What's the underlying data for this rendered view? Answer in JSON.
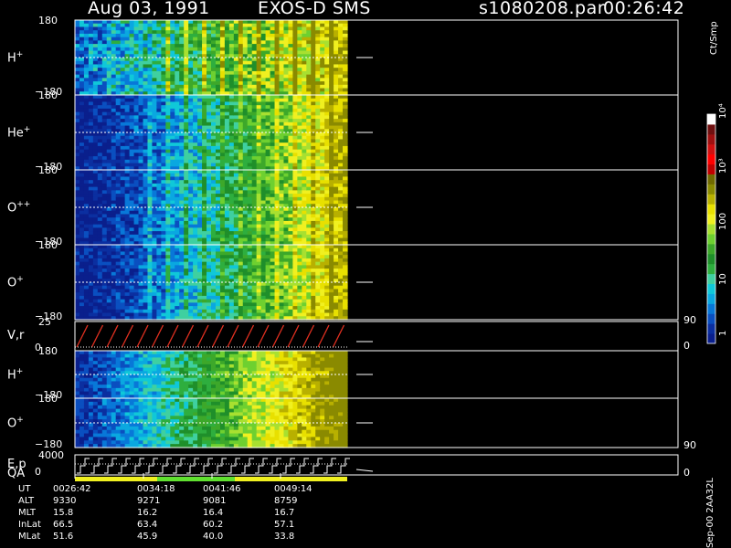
{
  "header": {
    "date": "Aug 03, 1991",
    "instrument": "EXOS-D SMS",
    "file": "s1080208.par",
    "time": "00:26:42"
  },
  "panels": [
    {
      "label": "H",
      "sup": "+",
      "top": "180",
      "bottom": "−180"
    },
    {
      "label": "He",
      "sup": "+",
      "top": "180",
      "bottom": "−180"
    },
    {
      "label": "O",
      "sup": "++",
      "top": "180",
      "bottom": "−180"
    },
    {
      "label": "O",
      "sup": "+",
      "top": "180",
      "bottom": "−180"
    },
    {
      "label": "V,r",
      "sup": "",
      "top": "25",
      "bottom": "0"
    },
    {
      "label": "H",
      "sup": "+",
      "top": "180",
      "bottom": "−180"
    },
    {
      "label": "O",
      "sup": "+",
      "top": "180",
      "bottom": "−180"
    },
    {
      "label": "E,p",
      "sup": "",
      "top": "4000",
      "bottom": "0"
    }
  ],
  "qa_label": "QA",
  "right_axis": {
    "vr_top": "90",
    "vr_bottom": "0",
    "ep_top": "90",
    "ep_bottom": "0"
  },
  "colorbar": {
    "unit": "Ct/Smp",
    "ticks": [
      "1",
      "10",
      "100",
      "10³",
      "10⁴"
    ],
    "colors": [
      "#0a1f8c",
      "#0b2fa0",
      "#0a4fc0",
      "#0878d8",
      "#0aa8e0",
      "#10c8d8",
      "#3fd0a0",
      "#2eae3e",
      "#1f8f2a",
      "#3da82a",
      "#6ed030",
      "#a8e030",
      "#f0f020",
      "#e8e000",
      "#b8b000",
      "#8a8a00",
      "#706a00",
      "#c00000",
      "#ff0000",
      "#d01010",
      "#a01010",
      "#701010",
      "#ffffff"
    ]
  },
  "ephemeris": {
    "rows": [
      {
        "name": "UT",
        "values": [
          "0026:42",
          "0034:18",
          "0041:46",
          "0049:14"
        ]
      },
      {
        "name": "ALT",
        "values": [
          "9330",
          "9271",
          "9081",
          "8759"
        ]
      },
      {
        "name": "MLT",
        "values": [
          "15.8",
          "16.2",
          "16.4",
          "16.7"
        ]
      },
      {
        "name": "InLat",
        "values": [
          "66.5",
          "63.4",
          "60.2",
          "57.1"
        ]
      },
      {
        "name": "MLat",
        "values": [
          "51.6",
          "45.9",
          "40.0",
          "33.8"
        ]
      }
    ]
  },
  "footer_code": "Sep-00 2AA32L",
  "chart_data": {
    "type": "heatmap",
    "title": "Aug 03, 1991   EXOS-D SMS",
    "x_ticks": [
      "0026:42",
      "0034:18",
      "0041:46",
      "0049:14"
    ],
    "color_scale": "log",
    "color_unit": "Ct/Smp",
    "panels": [
      "H+",
      "He+",
      "O++",
      "O+",
      "V,r",
      "H+",
      "O+",
      "E,p"
    ],
    "pitch_angle_range": [
      -180,
      180
    ],
    "vr_range": [
      0,
      25
    ],
    "ep_range": [
      0,
      4000
    ],
    "right_axis_range": [
      0,
      90
    ]
  }
}
